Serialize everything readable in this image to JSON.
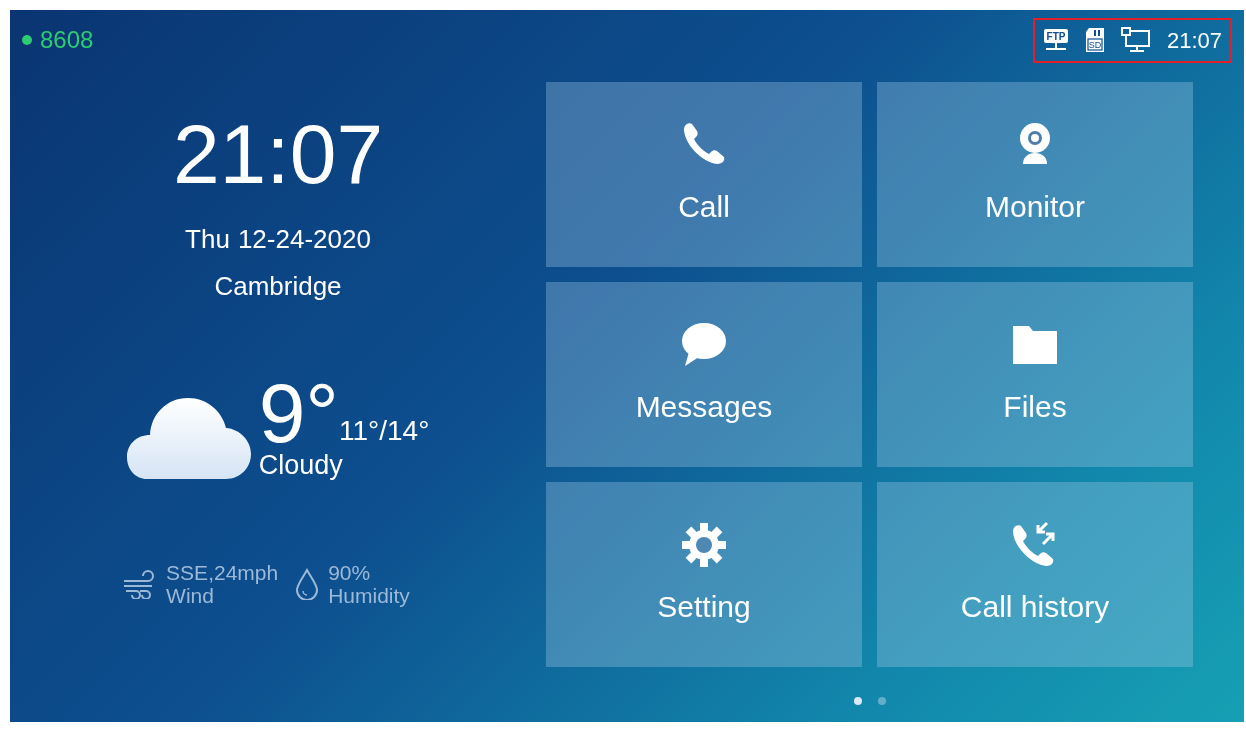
{
  "status_bar": {
    "account": {
      "number": "8608",
      "registered": true
    },
    "highlight": true,
    "icons": [
      {
        "kind": "ftp",
        "label": "FTP"
      },
      {
        "kind": "sd",
        "label": "SD"
      },
      {
        "kind": "network"
      }
    ],
    "time": "21:07"
  },
  "clock": {
    "time": "21:07",
    "day": "Thu",
    "date": "12-24-2020",
    "city": "Cambridge"
  },
  "weather": {
    "kind": "cloudy",
    "temperature": "9°",
    "range": "11°/14°",
    "condition": "Cloudy",
    "details": [
      {
        "kind": "wind",
        "value": "SSE,24mph",
        "label": "Wind"
      },
      {
        "kind": "humidity",
        "value": "90%",
        "label": "Humidity"
      }
    ]
  },
  "tiles": [
    {
      "kind": "call",
      "label": "Call"
    },
    {
      "kind": "monitor",
      "label": "Monitor"
    },
    {
      "kind": "messages",
      "label": "Messages"
    },
    {
      "kind": "files",
      "label": "Files"
    },
    {
      "kind": "setting",
      "label": "Setting"
    },
    {
      "kind": "call_history",
      "label": "Call history"
    }
  ],
  "pages": [
    {
      "selected": true
    },
    {
      "selected": false
    }
  ]
}
